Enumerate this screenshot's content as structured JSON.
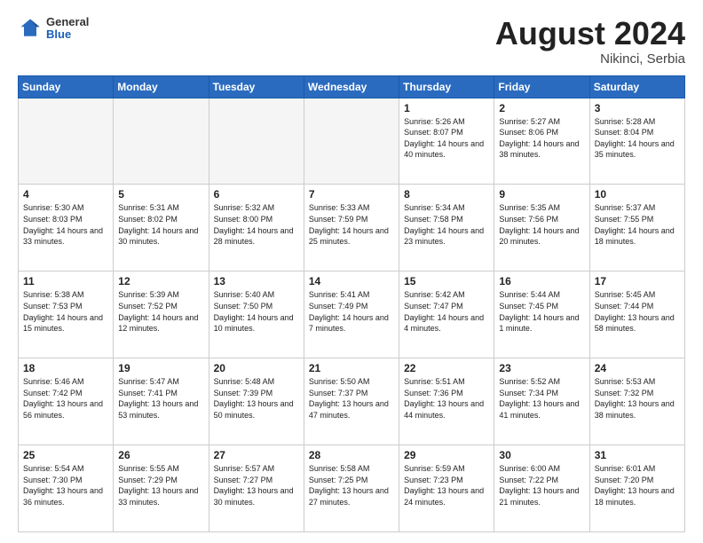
{
  "header": {
    "logo": {
      "general": "General",
      "blue": "Blue"
    },
    "title": "August 2024",
    "location": "Nikinci, Serbia"
  },
  "weekdays": [
    "Sunday",
    "Monday",
    "Tuesday",
    "Wednesday",
    "Thursday",
    "Friday",
    "Saturday"
  ],
  "weeks": [
    [
      {
        "day": "",
        "empty": true
      },
      {
        "day": "",
        "empty": true
      },
      {
        "day": "",
        "empty": true
      },
      {
        "day": "",
        "empty": true
      },
      {
        "day": "1",
        "sunrise": "5:26 AM",
        "sunset": "8:07 PM",
        "daylight": "14 hours and 40 minutes."
      },
      {
        "day": "2",
        "sunrise": "5:27 AM",
        "sunset": "8:06 PM",
        "daylight": "14 hours and 38 minutes."
      },
      {
        "day": "3",
        "sunrise": "5:28 AM",
        "sunset": "8:04 PM",
        "daylight": "14 hours and 35 minutes."
      }
    ],
    [
      {
        "day": "4",
        "sunrise": "5:30 AM",
        "sunset": "8:03 PM",
        "daylight": "14 hours and 33 minutes."
      },
      {
        "day": "5",
        "sunrise": "5:31 AM",
        "sunset": "8:02 PM",
        "daylight": "14 hours and 30 minutes."
      },
      {
        "day": "6",
        "sunrise": "5:32 AM",
        "sunset": "8:00 PM",
        "daylight": "14 hours and 28 minutes."
      },
      {
        "day": "7",
        "sunrise": "5:33 AM",
        "sunset": "7:59 PM",
        "daylight": "14 hours and 25 minutes."
      },
      {
        "day": "8",
        "sunrise": "5:34 AM",
        "sunset": "7:58 PM",
        "daylight": "14 hours and 23 minutes."
      },
      {
        "day": "9",
        "sunrise": "5:35 AM",
        "sunset": "7:56 PM",
        "daylight": "14 hours and 20 minutes."
      },
      {
        "day": "10",
        "sunrise": "5:37 AM",
        "sunset": "7:55 PM",
        "daylight": "14 hours and 18 minutes."
      }
    ],
    [
      {
        "day": "11",
        "sunrise": "5:38 AM",
        "sunset": "7:53 PM",
        "daylight": "14 hours and 15 minutes."
      },
      {
        "day": "12",
        "sunrise": "5:39 AM",
        "sunset": "7:52 PM",
        "daylight": "14 hours and 12 minutes."
      },
      {
        "day": "13",
        "sunrise": "5:40 AM",
        "sunset": "7:50 PM",
        "daylight": "14 hours and 10 minutes."
      },
      {
        "day": "14",
        "sunrise": "5:41 AM",
        "sunset": "7:49 PM",
        "daylight": "14 hours and 7 minutes."
      },
      {
        "day": "15",
        "sunrise": "5:42 AM",
        "sunset": "7:47 PM",
        "daylight": "14 hours and 4 minutes."
      },
      {
        "day": "16",
        "sunrise": "5:44 AM",
        "sunset": "7:45 PM",
        "daylight": "14 hours and 1 minute."
      },
      {
        "day": "17",
        "sunrise": "5:45 AM",
        "sunset": "7:44 PM",
        "daylight": "13 hours and 58 minutes."
      }
    ],
    [
      {
        "day": "18",
        "sunrise": "5:46 AM",
        "sunset": "7:42 PM",
        "daylight": "13 hours and 56 minutes."
      },
      {
        "day": "19",
        "sunrise": "5:47 AM",
        "sunset": "7:41 PM",
        "daylight": "13 hours and 53 minutes."
      },
      {
        "day": "20",
        "sunrise": "5:48 AM",
        "sunset": "7:39 PM",
        "daylight": "13 hours and 50 minutes."
      },
      {
        "day": "21",
        "sunrise": "5:50 AM",
        "sunset": "7:37 PM",
        "daylight": "13 hours and 47 minutes."
      },
      {
        "day": "22",
        "sunrise": "5:51 AM",
        "sunset": "7:36 PM",
        "daylight": "13 hours and 44 minutes."
      },
      {
        "day": "23",
        "sunrise": "5:52 AM",
        "sunset": "7:34 PM",
        "daylight": "13 hours and 41 minutes."
      },
      {
        "day": "24",
        "sunrise": "5:53 AM",
        "sunset": "7:32 PM",
        "daylight": "13 hours and 38 minutes."
      }
    ],
    [
      {
        "day": "25",
        "sunrise": "5:54 AM",
        "sunset": "7:30 PM",
        "daylight": "13 hours and 36 minutes."
      },
      {
        "day": "26",
        "sunrise": "5:55 AM",
        "sunset": "7:29 PM",
        "daylight": "13 hours and 33 minutes."
      },
      {
        "day": "27",
        "sunrise": "5:57 AM",
        "sunset": "7:27 PM",
        "daylight": "13 hours and 30 minutes."
      },
      {
        "day": "28",
        "sunrise": "5:58 AM",
        "sunset": "7:25 PM",
        "daylight": "13 hours and 27 minutes."
      },
      {
        "day": "29",
        "sunrise": "5:59 AM",
        "sunset": "7:23 PM",
        "daylight": "13 hours and 24 minutes."
      },
      {
        "day": "30",
        "sunrise": "6:00 AM",
        "sunset": "7:22 PM",
        "daylight": "13 hours and 21 minutes."
      },
      {
        "day": "31",
        "sunrise": "6:01 AM",
        "sunset": "7:20 PM",
        "daylight": "13 hours and 18 minutes."
      }
    ]
  ]
}
